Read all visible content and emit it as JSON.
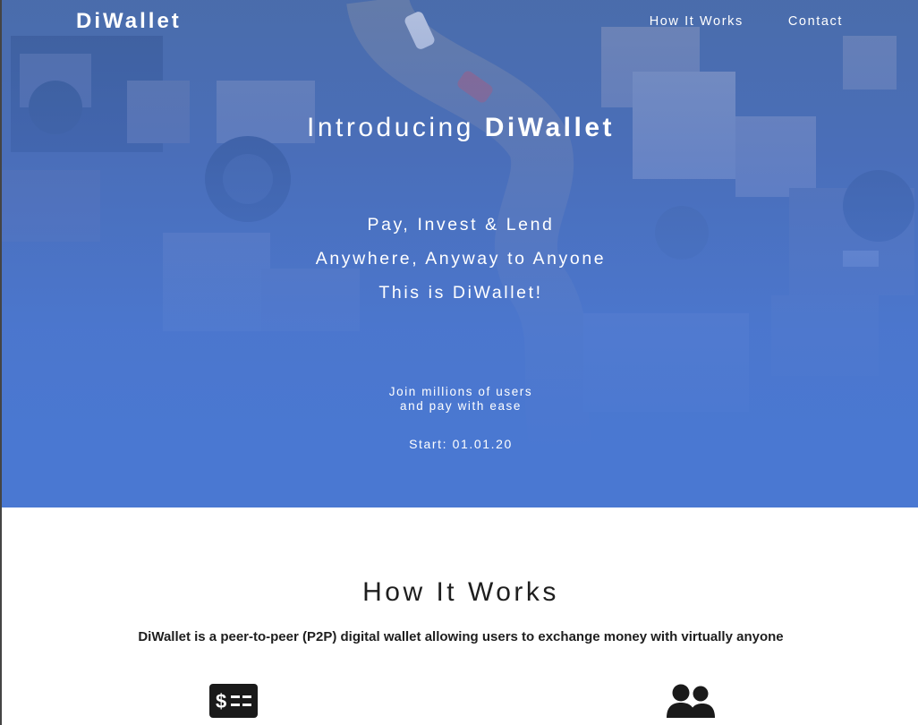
{
  "header": {
    "brand": "DiWallet",
    "nav": [
      {
        "label": "How It Works"
      },
      {
        "label": "Contact"
      }
    ]
  },
  "hero": {
    "headline_prefix": "Introducing",
    "headline_brand": "DiWallet",
    "tagline_lines": [
      "Pay, Invest & Lend",
      "Anywhere, Anyway to Anyone",
      "This is DiWallet!"
    ],
    "join_lines": [
      "Join millions of users",
      "and pay with ease"
    ],
    "start": "Start: 01.01.20"
  },
  "how_it_works": {
    "title": "How It Works",
    "description": "DiWallet is a peer-to-peer (P2P) digital wallet allowing users to exchange money with virtually anyone",
    "icons": [
      "money-check-icon",
      "users-icon"
    ]
  },
  "colors": {
    "hero_blue": "#4a78d0",
    "text_dark": "#1e1e1e",
    "icon_dark": "#1a1a1a"
  }
}
